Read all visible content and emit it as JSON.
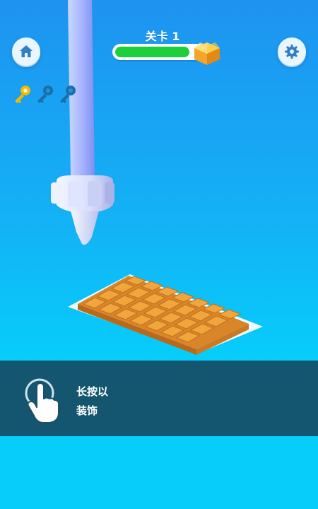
{
  "hud": {
    "level_label": "关卡 1",
    "progress": 0.83,
    "progress_color": "#1ccf3c",
    "home_icon": "home-icon",
    "settings_icon": "gear-icon",
    "reward_icon": "gift-box-icon"
  },
  "keys": {
    "total": 3,
    "collected": 1,
    "collected_color": "#f5b800",
    "empty_color": "#1a6fa8"
  },
  "scene": {
    "background_top": "#1e93f0",
    "background_bottom": "#06cdfa",
    "waffle_color": "#e8962a"
  },
  "tutorial": {
    "line1": "长按以",
    "line2": "装饰",
    "icon": "hand-tap-icon",
    "panel_color": "#14566f"
  }
}
